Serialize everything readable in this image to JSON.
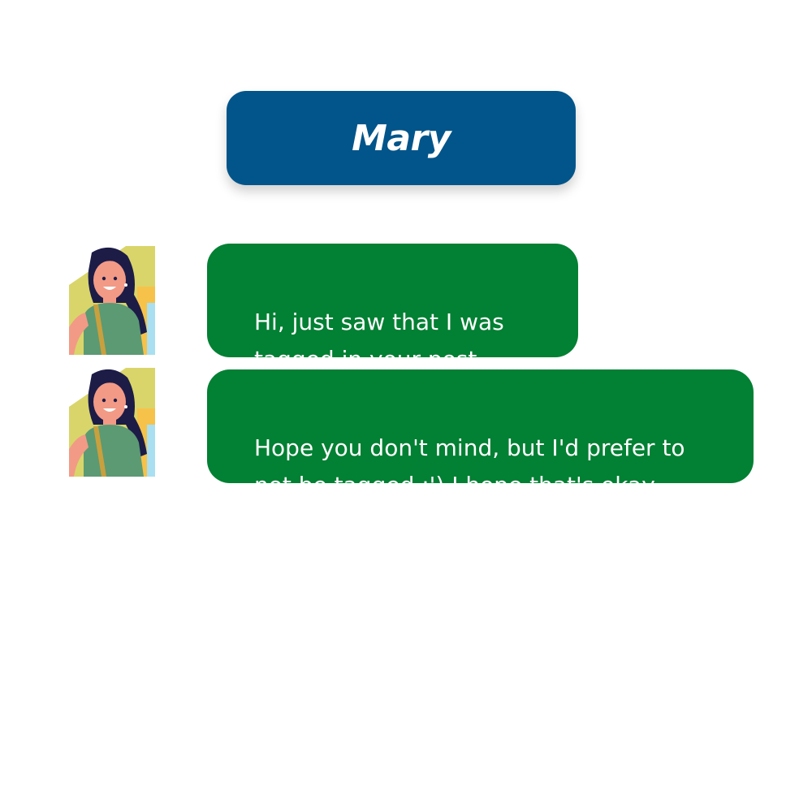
{
  "header": {
    "name": "Mary",
    "color": "#02558a"
  },
  "messages": [
    {
      "avatar_icon": "woman-avatar-icon",
      "text": "Hi, just saw that I was\ntagged in your post.",
      "color": "#028033"
    },
    {
      "avatar_icon": "woman-avatar-icon",
      "text": "Hope you don't mind, but I'd prefer to\nnot be tagged :') I hope that's okay",
      "color": "#028033"
    }
  ]
}
